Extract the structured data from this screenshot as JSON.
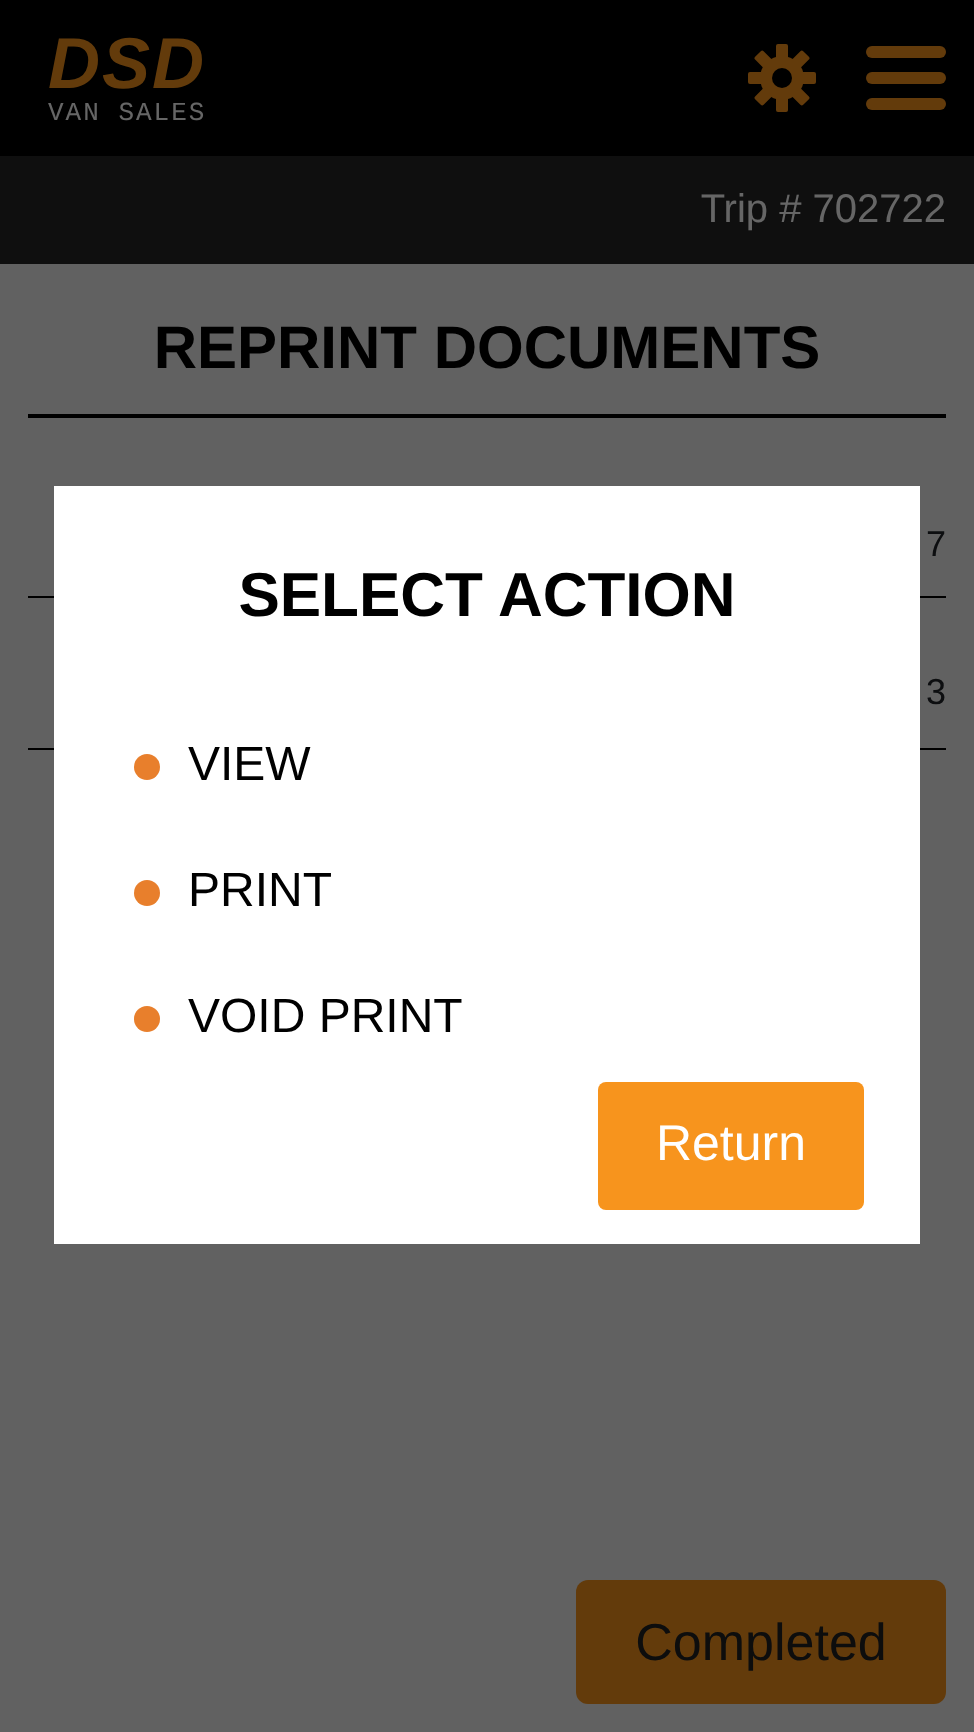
{
  "header": {
    "logo_top": "DSD",
    "logo_bottom": "VAN SALES"
  },
  "trip": "Trip # 702722",
  "title": "REPRINT DOCUMENTS",
  "rows": [
    {
      "value": "7"
    },
    {
      "value": "3"
    }
  ],
  "footer_button": "Completed",
  "dialog": {
    "title": "SELECT ACTION",
    "options": [
      {
        "label": "VIEW",
        "color": "#e87f2c"
      },
      {
        "label": "PRINT",
        "color": "#e87f2c"
      },
      {
        "label": "VOID PRINT",
        "color": "#e87f2c"
      }
    ],
    "button": "Return"
  }
}
